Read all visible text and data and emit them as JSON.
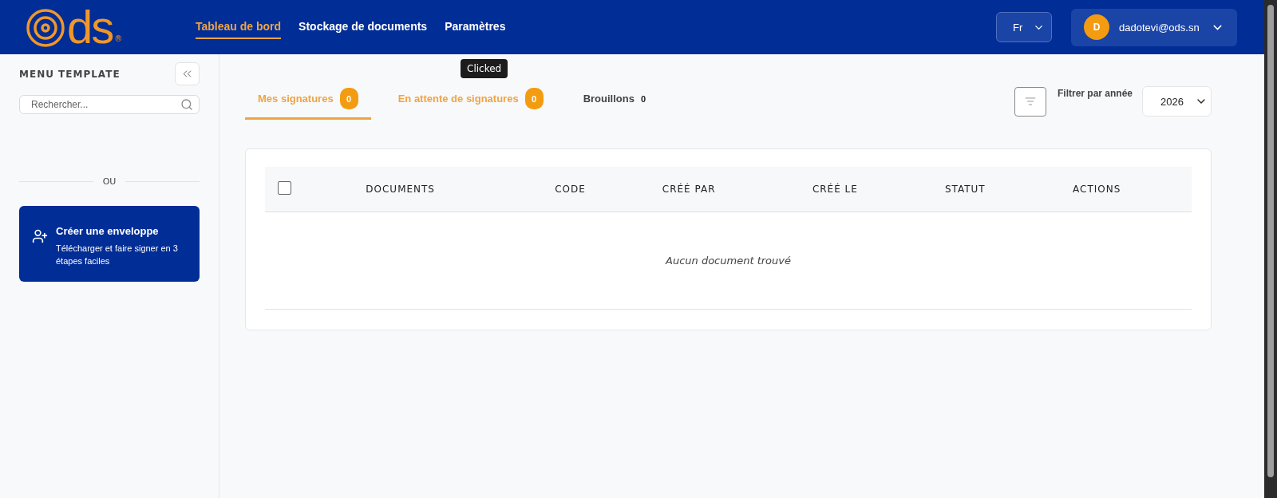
{
  "header": {
    "logo": "ds",
    "logo_mark": "®",
    "nav": [
      {
        "label": "Tableau de bord",
        "selected": true
      },
      {
        "label": "Stockage de documents",
        "selected": false
      },
      {
        "label": "Paramètres",
        "selected": false
      }
    ],
    "language": "Fr",
    "user": {
      "initial": "D",
      "email": "dadotevi@ods.sn"
    }
  },
  "sidebar": {
    "title": "MENU TEMPLATE",
    "search": {
      "placeholder": "Rechercher..."
    },
    "divider": "OU",
    "create_card": {
      "title": "Créer une enveloppe",
      "description": "Télécharger et faire signer en 3 étapes faciles"
    }
  },
  "tabs": [
    {
      "label": "Mes signatures",
      "count": "0",
      "selected": true,
      "kind": "badge"
    },
    {
      "label": "En attente de signatures",
      "count": "0",
      "selected": false,
      "kind": "badge"
    },
    {
      "label": "Brouillons",
      "count": "0",
      "selected": false,
      "kind": "plain"
    }
  ],
  "tooltip": "Clicked",
  "filter": {
    "label": "Filtrer par année",
    "year": "2026"
  },
  "table": {
    "select_all": {
      "checked": false
    },
    "columns": [
      "DOCUMENTS",
      "CODE",
      "CRÉÉ PAR",
      "CRÉÉ LE",
      "STATUT",
      "ACTIONS"
    ],
    "empty_message": "Aucun document trouvé"
  }
}
